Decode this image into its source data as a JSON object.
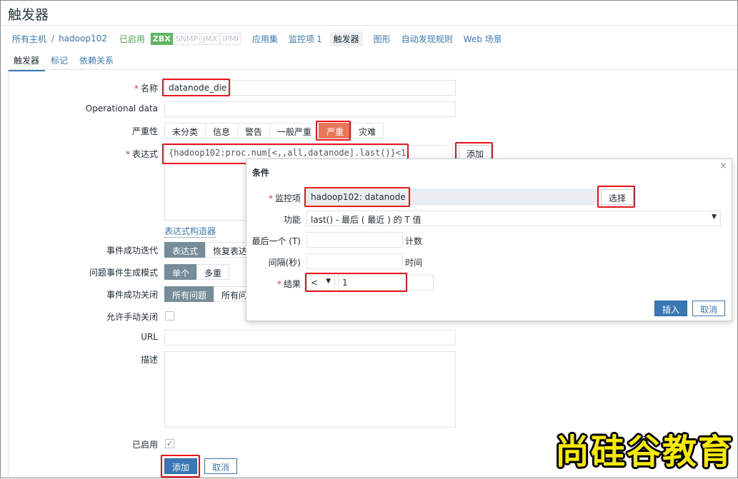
{
  "page_title": "触发器",
  "breadcrumb": {
    "all_hosts": "所有主机",
    "separator": "/",
    "host": "hadoop102",
    "status": "已启用",
    "protocols": [
      "ZBX",
      "SNMP",
      "JMX",
      "IPMI"
    ]
  },
  "host_nav": [
    {
      "label": "应用集",
      "count": ""
    },
    {
      "label": "监控项",
      "count": "1"
    },
    {
      "label": "触发器",
      "count": "",
      "active": true
    },
    {
      "label": "图形",
      "count": ""
    },
    {
      "label": "自动发现规则",
      "count": ""
    },
    {
      "label": "Web 场景",
      "count": ""
    }
  ],
  "tabs": [
    "触发器",
    "标记",
    "依赖关系"
  ],
  "form": {
    "name_label": "名称",
    "name_value": "datanode_die",
    "opdata_label": "Operational data",
    "opdata_value": "",
    "severity_label": "严重性",
    "severities": [
      "未分类",
      "信息",
      "警告",
      "一般严重",
      "严重",
      "灾难"
    ],
    "severity_selected": "严重",
    "expression_label": "表达式",
    "expression_value": "{hadoop102:proc.num[<,,all,datanode].last()}<1",
    "add_expr_button": "添加",
    "expr_builder_link": "表达式构造器",
    "ok_event_gen_label": "事件成功迭代",
    "ok_event_gen_options": [
      "表达式",
      "恢复表达"
    ],
    "problem_mode_label": "问题事件生成模式",
    "problem_mode_options": [
      "单个",
      "多重"
    ],
    "ok_close_label": "事件成功关闭",
    "ok_close_options": [
      "所有问题",
      "所有问"
    ],
    "manual_close_label": "允许手动关闭",
    "url_label": "URL",
    "url_value": "",
    "desc_label": "描述",
    "desc_value": "",
    "enabled_label": "已启用",
    "enabled_check": "✓",
    "submit_button": "添加",
    "cancel_button": "取消"
  },
  "dialog": {
    "title": "条件",
    "close": "×",
    "item_label": "监控项",
    "item_value": "hadoop102: datanode",
    "select_button": "选择",
    "function_label": "功能",
    "function_value": "last() - 最后 ( 最近 ) 的 T 值",
    "last_of_label": "最后一个 (T)",
    "last_of_value": "",
    "last_of_suffix": "计数",
    "interval_label": "间隔(秒)",
    "interval_value": "",
    "interval_suffix": "时间",
    "result_label": "结果",
    "result_operator": "<",
    "result_value": "1",
    "insert_button": "插入",
    "cancel_button": "取消"
  },
  "watermark": "尚硅谷教育",
  "colors": {
    "accent": "#3a78b5",
    "severity_high": "#e97659",
    "highlight": "#e8131b",
    "enabled_green": "#4fa650"
  }
}
